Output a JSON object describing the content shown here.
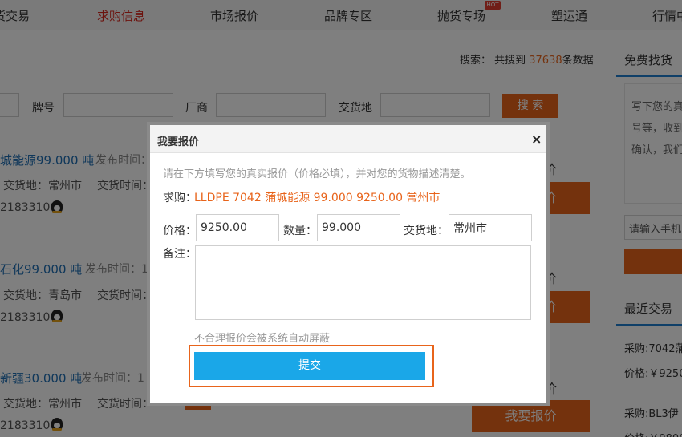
{
  "nav": {
    "items": [
      "货交易",
      "求购信息",
      "市场报价",
      "品牌专区",
      "抛货专场",
      "塑运通",
      "行情中"
    ],
    "active_index": 1,
    "hot_badge": "HOT"
  },
  "stats": {
    "prefix": "搜索：  共搜到 ",
    "count": "37638",
    "suffix": "条数据"
  },
  "filters": {
    "brand_label": "牌号",
    "maker_label": "厂商",
    "delivery_label": "交货地",
    "search_button": "搜 索"
  },
  "listings": [
    {
      "title": "城能源99.000 吨",
      "published_label": "发布时间：",
      "delivery": "交货地：常州市",
      "delivery_time": "交货时间：",
      "phone": "21833100"
    },
    {
      "title": "石化99.000 吨",
      "published_label": "发布时间：1",
      "delivery": "交货地：青岛市",
      "delivery_time": "交货时间：",
      "phone": "21833100"
    },
    {
      "title": "新疆30.000 吨",
      "published_label": "发布时间：1",
      "delivery": "交货地：常州市",
      "delivery_time": "交货时间：",
      "phone": "21833100"
    }
  ],
  "quote_button": "我要报价",
  "quote_partial": [
    "价",
    "价",
    "价"
  ],
  "sidebar": {
    "free_find": "免费找货",
    "desc_lines": [
      "写下您的真",
      "号等，收到",
      "确认，我们"
    ],
    "input_placeholder": "请输入手机",
    "recent_trades": "最近交易",
    "trades": [
      "采购:7042蒲",
      "价格:￥9250",
      "采购:BL3伊",
      "价格:￥9800"
    ]
  },
  "modal": {
    "title": "我要报价",
    "close": "×",
    "hint": "请在下方填写您的真实报价（价格必填），并对您的货物描述清楚。",
    "purchase_label": "求购：",
    "purchase_value": "LLDPE 7042 蒲城能源 99.000 9250.00 常州市",
    "price_label": "价格：",
    "price_value": "9250.00",
    "qty_label": "数量：",
    "qty_value": "99.000",
    "place_label": "交货地：",
    "place_value": "常州市",
    "remark_label": "备注：",
    "remark_value": "",
    "warning": "不合理报价会被系统自动屏蔽",
    "submit": "提交"
  }
}
